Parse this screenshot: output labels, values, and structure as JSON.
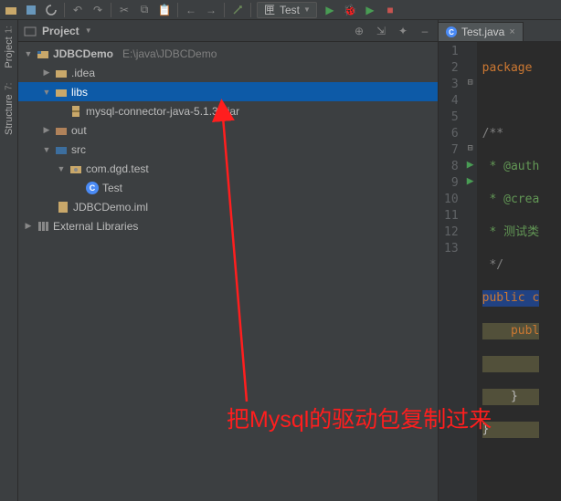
{
  "toolbar": {
    "run_config_label": "Test",
    "run_config_prefix": "匣"
  },
  "left_tabs": {
    "project_num": "1:",
    "project_label": "Project",
    "structure_num": "7:",
    "structure_label": "Structure"
  },
  "panel": {
    "icon_label": "Project",
    "title": "Project"
  },
  "tree": {
    "root_name": "JDBCDemo",
    "root_path": "E:\\java\\JDBCDemo",
    "idea": ".idea",
    "libs": "libs",
    "mysql_jar": "mysql-connector-java-5.1.30.jar",
    "out": "out",
    "src": "src",
    "pkg": "com.dgd.test",
    "test_class": "Test",
    "iml": "JDBCDemo.iml",
    "ext_libs": "External Libraries"
  },
  "editor": {
    "tab_label": "Test.java",
    "lines": {
      "l1": "package",
      "l2": "",
      "l3": "/**",
      "l4": " * @auth",
      "l5": " * @crea",
      "l6": " * 测试类",
      "l7": " */",
      "l8": "public c",
      "l9": "    publ",
      "l10": "",
      "l11": "    }",
      "l12": "}",
      "l13": ""
    },
    "nums": [
      "1",
      "2",
      "3",
      "4",
      "5",
      "6",
      "7",
      "8",
      "9",
      "10",
      "11",
      "12",
      "13"
    ]
  },
  "annotation": {
    "text": "把Mysql的驱动包复制过来"
  }
}
